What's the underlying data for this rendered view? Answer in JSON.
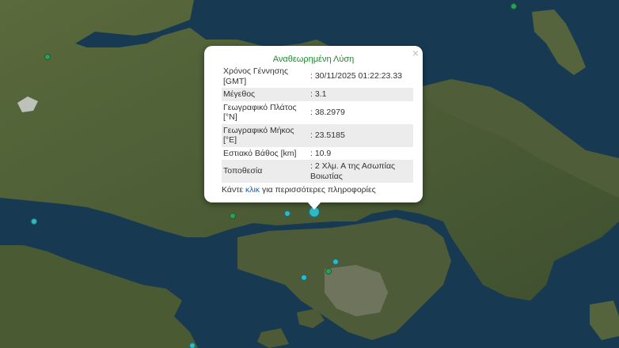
{
  "popup": {
    "close_label": "×",
    "title": "Αναθεωρημένη Λύση",
    "rows": [
      {
        "label": "Χρόνος Γέννησης [GMT]",
        "value": ": 30/11/2025 01:22:23.33"
      },
      {
        "label": "Μέγεθος",
        "value": ": 3.1"
      },
      {
        "label": "Γεωγραφικό Πλάτος [°N]",
        "value": ": 38.2979"
      },
      {
        "label": "Γεωγραφικό Μήκος [°E]",
        "value": ": 23.5185"
      },
      {
        "label": "Εστιακό Βάθος [km]",
        "value": ": 10.9"
      },
      {
        "label": "Τοποθεσία",
        "value": ": 2 Χλμ. Α της Ασωπίας Βοιωτίας"
      }
    ],
    "more_prefix": "Κάντε ",
    "more_link": "κλικ",
    "more_suffix": " για περισσότερες πληροφορίες"
  },
  "map": {
    "sea_color": "#173a52",
    "land_color": "#4a5a35",
    "quake_marker_color": "#2fb9c7",
    "green_marker_color": "#2e9e5a"
  }
}
